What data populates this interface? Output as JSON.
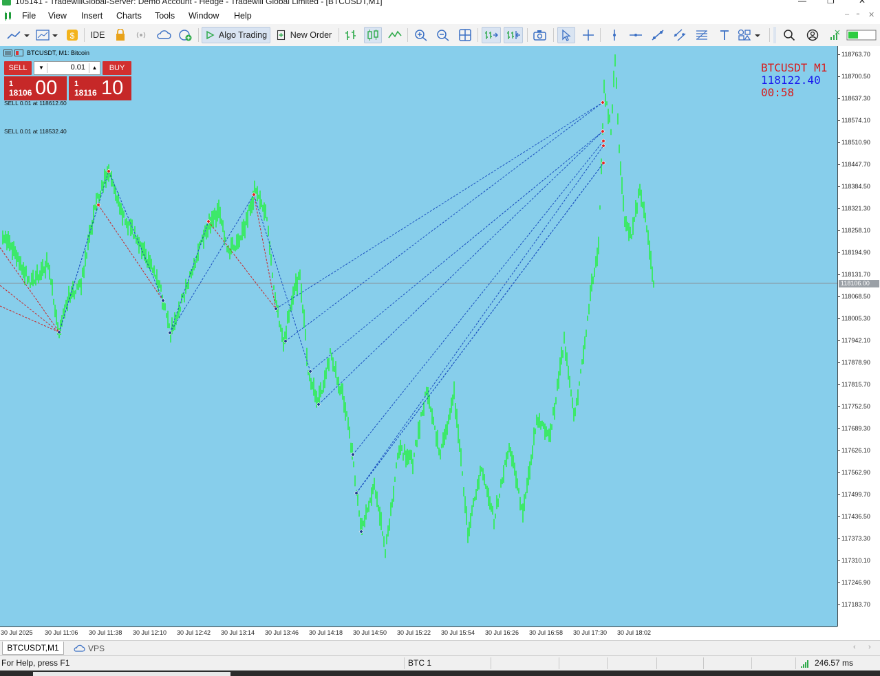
{
  "window": {
    "title": "105141 - TradewillGlobal-Server: Demo Account - Hedge - Tradewill Global Limited - [BTCUSDT,M1]"
  },
  "menu": [
    "File",
    "View",
    "Insert",
    "Charts",
    "Tools",
    "Window",
    "Help"
  ],
  "toolbar": {
    "ide_label": "IDE",
    "algo_label": "Algo Trading",
    "new_order_label": "New Order"
  },
  "chart": {
    "header": "BTCUSDT, M1:  Bitcoin",
    "symbol_tf": "BTCUSDT M1",
    "current_price": "118122.40",
    "countdown": "00:58",
    "bid_line_label": "118106.00",
    "position_labels": [
      "SELL 0.01 at 118612.60",
      "SELL 0.01 at 118532.40"
    ],
    "colors": {
      "background": "#87ceeb",
      "bars": "#00ff00",
      "sell_marker": "#dd2222",
      "buy_marker": "#1b3f8f",
      "buy_line": "#1a4fbf",
      "sell_line": "#cc2222"
    }
  },
  "one_click": {
    "sell_label": "SELL",
    "buy_label": "BUY",
    "volume": "0.01",
    "sell_price_small_top": "1",
    "sell_price_small": "18106",
    "sell_price_big": "00",
    "buy_price_small_top": "1",
    "buy_price_small": "18116",
    "buy_price_big": "10"
  },
  "price_axis": [
    "118763.70",
    "118700.50",
    "118637.30",
    "118574.10",
    "118510.90",
    "118447.70",
    "118384.50",
    "118321.30",
    "118258.10",
    "118194.90",
    "118131.70",
    "118068.50",
    "118005.30",
    "117942.10",
    "117878.90",
    "117815.70",
    "117752.50",
    "117689.30",
    "117626.10",
    "117562.90",
    "117499.70",
    "117436.50",
    "117373.30",
    "117310.10",
    "117246.90",
    "117183.70"
  ],
  "time_axis": [
    "30 Jul 2025",
    "30 Jul 11:06",
    "30 Jul 11:38",
    "30 Jul 12:10",
    "30 Jul 12:42",
    "30 Jul 13:14",
    "30 Jul 13:46",
    "30 Jul 14:18",
    "30 Jul 14:50",
    "30 Jul 15:22",
    "30 Jul 15:54",
    "30 Jul 16:26",
    "30 Jul 16:58",
    "30 Jul 17:30",
    "30 Jul 18:02"
  ],
  "tabs": [
    {
      "label": "BTCUSDT,M1",
      "active": true
    },
    {
      "label": "VPS",
      "active": false
    }
  ],
  "status": {
    "help": "For Help, press F1",
    "profile": "BTC 1",
    "ping": "246.57 ms"
  }
}
